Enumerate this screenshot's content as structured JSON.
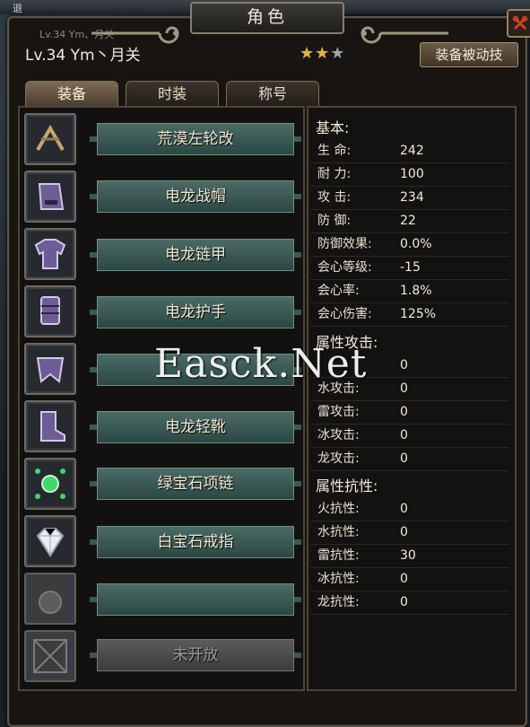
{
  "background": {
    "top_fragment": "退",
    "ghost_text": "Lv.34 Ym、月关"
  },
  "window": {
    "title": "角色",
    "close_icon": "close-icon"
  },
  "character": {
    "level_name": "Lv.34  Ym丶月关",
    "stars_filled": 2,
    "stars_total": 3
  },
  "skill_button": "装备被动技",
  "tabs": [
    {
      "label": "装备",
      "active": true
    },
    {
      "label": "时装",
      "active": false
    },
    {
      "label": "称号",
      "active": false
    }
  ],
  "equipment": [
    {
      "icon": "boomerang-icon",
      "name": "荒漠左轮改"
    },
    {
      "icon": "helmet-icon",
      "name": "电龙战帽"
    },
    {
      "icon": "armor-icon",
      "name": "电龙链甲"
    },
    {
      "icon": "gauntlet-icon",
      "name": "电龙护手"
    },
    {
      "icon": "leg-armor-icon",
      "name": ""
    },
    {
      "icon": "boots-icon",
      "name": "电龙轻靴"
    },
    {
      "icon": "emerald-necklace-icon",
      "name": "绿宝石项链"
    },
    {
      "icon": "diamond-ring-icon",
      "name": "白宝石戒指"
    },
    {
      "icon": "empty-slot-icon",
      "name": ""
    },
    {
      "icon": "locked-slot-icon",
      "name": "未开放",
      "locked": true
    }
  ],
  "stats": {
    "basic_heading": "基本:",
    "basic": [
      {
        "label": "生 命:",
        "value": "242"
      },
      {
        "label": "耐 力:",
        "value": "100"
      },
      {
        "label": "攻 击:",
        "value": "234"
      },
      {
        "label": "防 御:",
        "value": "22"
      },
      {
        "label": "防御效果:",
        "value": "0.0%"
      },
      {
        "label": "会心等级:",
        "value": "-15"
      },
      {
        "label": "会心率:",
        "value": "1.8%"
      },
      {
        "label": "会心伤害:",
        "value": "125%"
      }
    ],
    "attack_heading": "属性攻击:",
    "attack": [
      {
        "label": "",
        "value": "0"
      },
      {
        "label": "水攻击:",
        "value": "0"
      },
      {
        "label": "雷攻击:",
        "value": "0"
      },
      {
        "label": "冰攻击:",
        "value": "0"
      },
      {
        "label": "龙攻击:",
        "value": "0"
      }
    ],
    "resist_heading": "属性抗性:",
    "resist": [
      {
        "label": "火抗性:",
        "value": "0"
      },
      {
        "label": "水抗性:",
        "value": "0"
      },
      {
        "label": "雷抗性:",
        "value": "30"
      },
      {
        "label": "冰抗性:",
        "value": "0"
      },
      {
        "label": "龙抗性:",
        "value": "0"
      }
    ]
  },
  "watermark": "Easck.Net",
  "colors": {
    "star_gold": "#e0b43a",
    "name_bar": "#3b5955",
    "close_red": "#d04028"
  }
}
